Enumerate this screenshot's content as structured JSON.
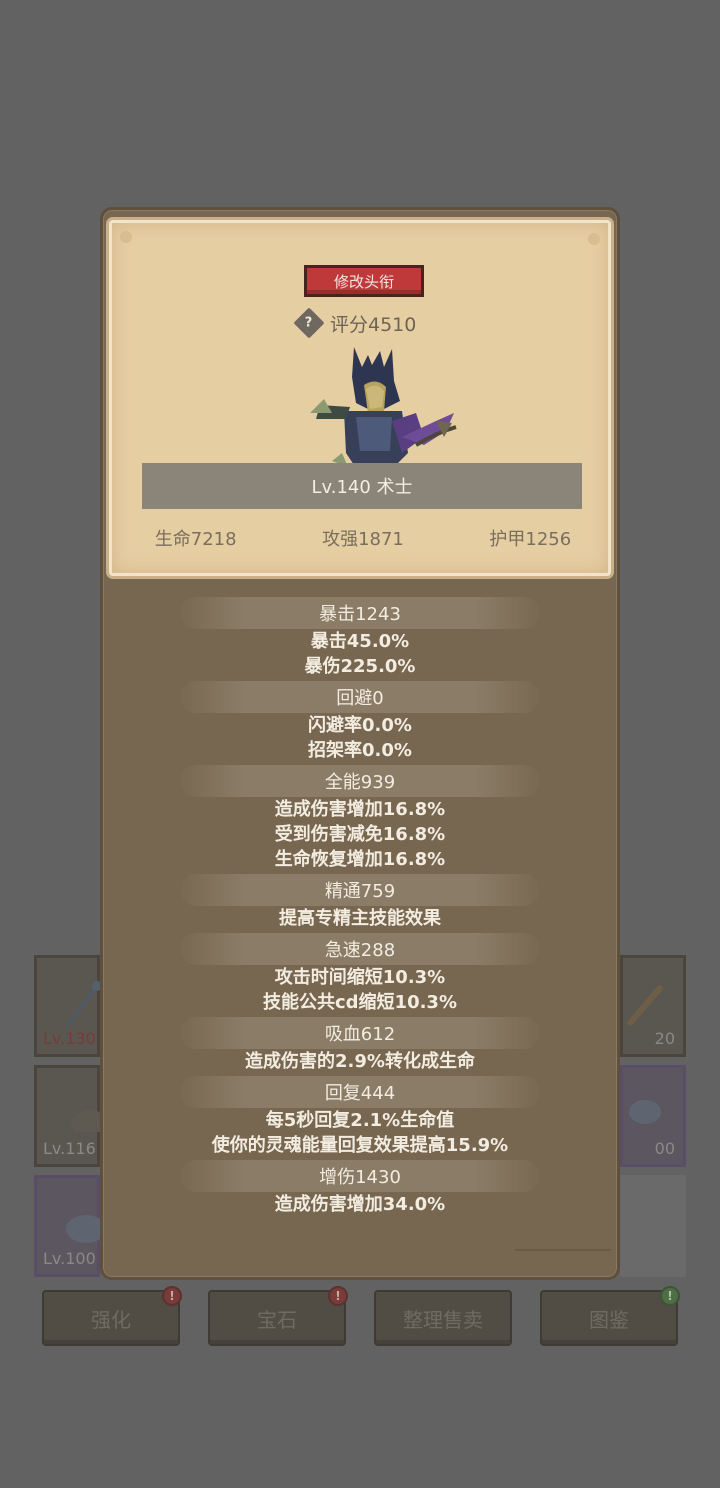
{
  "popup": {
    "title_button": "修改头衔",
    "score": "评分4510",
    "help_glyph": "?",
    "level_class": "Lv.140 术士",
    "main_stats": [
      "生命7218",
      "攻强1871",
      "护甲1256"
    ],
    "stat_groups": [
      {
        "header": "暴击1243",
        "details": [
          "暴击45.0%",
          "暴伤225.0%"
        ]
      },
      {
        "header": "回避0",
        "details": [
          "闪避率0.0%",
          "招架率0.0%"
        ]
      },
      {
        "header": "全能939",
        "details": [
          "造成伤害增加16.8%",
          "受到伤害减免16.8%",
          "生命恢复增加16.8%"
        ]
      },
      {
        "header": "精通759",
        "details": [
          "提高专精主技能效果"
        ]
      },
      {
        "header": "急速288",
        "details": [
          "攻击时间缩短10.3%",
          "技能公共cd缩短10.3%"
        ]
      },
      {
        "header": "吸血612",
        "details": [
          "造成伤害的2.9%转化成生命"
        ]
      },
      {
        "header": "回复444",
        "details": [
          "每5秒回复2.1%生命值",
          "使你的灵魂能量回复效果提高15.9%"
        ]
      },
      {
        "header": "增伤1430",
        "details": [
          "造成伤害增加34.0%"
        ]
      }
    ]
  },
  "background": {
    "slots_left": [
      "Lv.130",
      "Lv.116",
      "Lv.100"
    ],
    "slots_right": [
      "20",
      "00"
    ],
    "buttons": [
      {
        "label": "强化",
        "badge": "!"
      },
      {
        "label": "宝石",
        "badge": "!"
      },
      {
        "label": "整理售卖",
        "badge": ""
      },
      {
        "label": "图鉴",
        "badge": "!"
      }
    ]
  },
  "colors": {
    "overlay": "#626262",
    "popup": "#776650",
    "card": "#e6cea3",
    "title_button": "#c0393a"
  }
}
